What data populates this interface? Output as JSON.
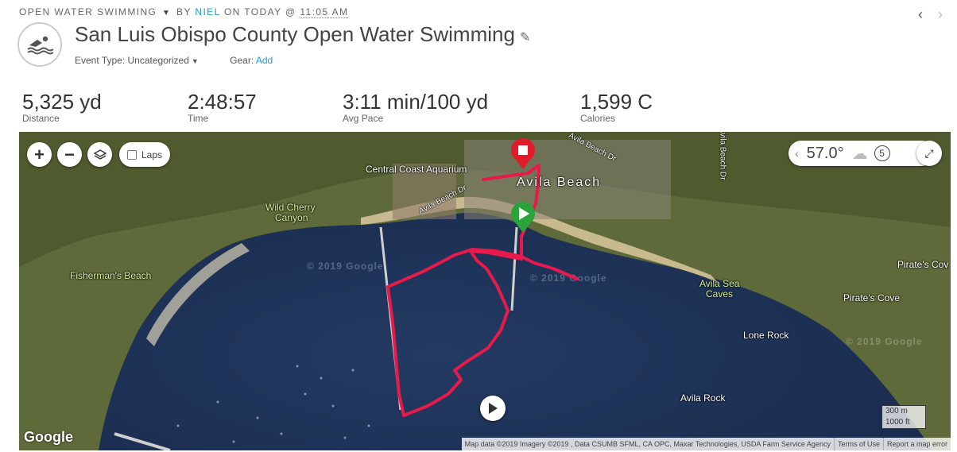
{
  "header": {
    "activity_type": "OPEN WATER SWIMMING",
    "by": "BY",
    "user": "NIEL",
    "on": "ON TODAY @",
    "time": "11:05 AM",
    "title": "San Luis Obispo County Open Water Swimming",
    "event_type_label": "Event Type:",
    "event_type_value": "Uncategorized",
    "gear_label": "Gear:",
    "gear_action": "Add"
  },
  "stats": [
    {
      "value": "5,325 yd",
      "label": "Distance"
    },
    {
      "value": "2:48:57",
      "label": "Time"
    },
    {
      "value": "3:11 min/100 yd",
      "label": "Avg Pace"
    },
    {
      "value": "1,599 C",
      "label": "Calories"
    }
  ],
  "map": {
    "controls": {
      "zoom_in": "+",
      "zoom_out": "−",
      "laps_label": "Laps"
    },
    "weather": {
      "temperature": "57.0°",
      "wind": "5"
    },
    "labels": {
      "aquarium": "Central Coast Aquarium",
      "avila_beach": "Avila Beach",
      "avila_beach_dr_1": "Avila Beach Dr",
      "avila_beach_dr_2": "Avila Beach Dr",
      "avila_beach_dr_3": "Avila Beach Dr",
      "wild_cherry": "Wild Cherry",
      "canyon": "Canyon",
      "fishermans_beach": "Fisherman's Beach",
      "avila_sea": "Avila Sea",
      "caves": "Caves",
      "pirates_cove_1": "Pirate's Cov",
      "pirates_cove_2": "Pirate's Cove",
      "lone_rock": "Lone Rock",
      "avila_rock": "Avila Rock"
    },
    "watermarks": [
      "© 2019 Google",
      "© 2019 Google",
      "© 2019 Google"
    ],
    "scale": {
      "metric": "300 m",
      "imperial": "1000 ft"
    },
    "logo": "Google",
    "attribution": "Map data ©2019 Imagery ©2019 , Data CSUMB SFML, CA OPC, Maxar Technologies, USDA Farm Service Agency",
    "terms": "Terms of Use",
    "report": "Report a map error",
    "route_color": "#e8194b",
    "start_color": "#2aa33a",
    "end_color": "#e01b2a"
  }
}
